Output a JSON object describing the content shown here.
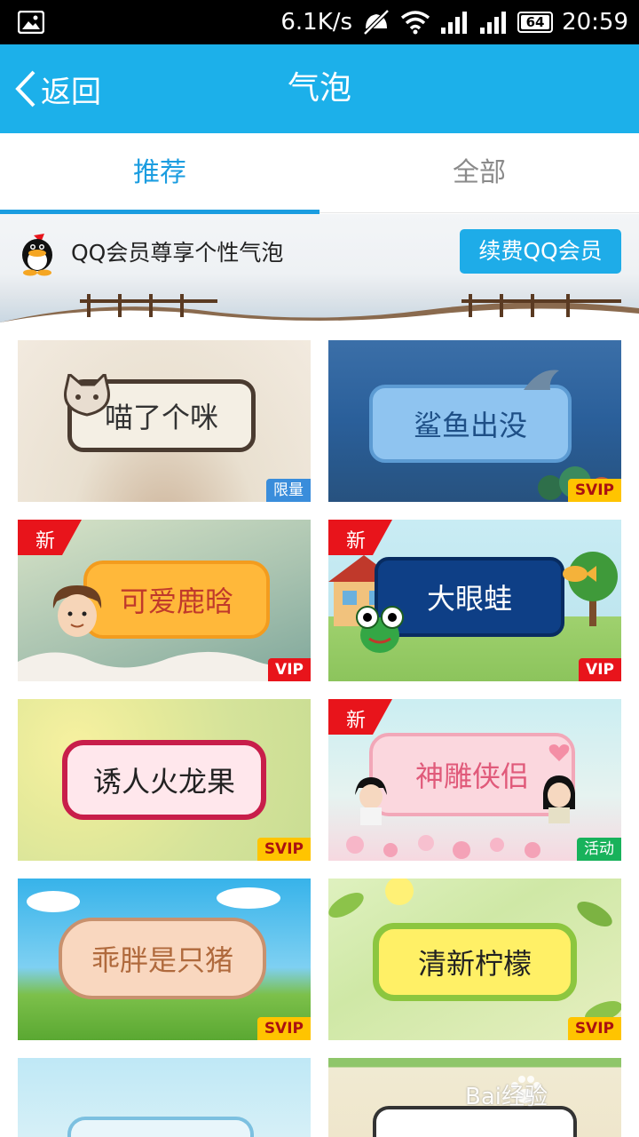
{
  "status_bar": {
    "network_speed": "6.1K/s",
    "battery": "64",
    "time": "20:59"
  },
  "header": {
    "back_label": "返回",
    "title": "气泡"
  },
  "tabs": [
    {
      "label": "推荐",
      "active": true
    },
    {
      "label": "全部",
      "active": false
    }
  ],
  "banner": {
    "text": "QQ会员尊享个性气泡",
    "button_label": "续费QQ会员"
  },
  "bubbles": [
    {
      "name": "喵了个咪",
      "badge": "限量",
      "is_new": false
    },
    {
      "name": "鲨鱼出没",
      "badge": "SVIP",
      "is_new": false
    },
    {
      "name": "可爱鹿晗",
      "badge": "VIP",
      "is_new": true
    },
    {
      "name": "大眼蛙",
      "badge": "VIP",
      "is_new": true
    },
    {
      "name": "诱人火龙果",
      "badge": "SVIP",
      "is_new": false
    },
    {
      "name": "神雕侠侣",
      "badge": "活动",
      "is_new": true
    },
    {
      "name": "乖胖是只猪",
      "badge": "SVIP",
      "is_new": false
    },
    {
      "name": "清新柠檬",
      "badge": "SVIP",
      "is_new": false
    }
  ],
  "new_tag_label": "新",
  "watermark_text": "Bai经验",
  "colors": {
    "brand_blue": "#1cb0ea",
    "tab_active": "#1b9de0",
    "svip_badge": "#ffc400",
    "vip_badge": "#e8141b",
    "limited_badge": "#3a8ddb",
    "event_badge": "#18b25b",
    "new_tag": "#e8141b"
  }
}
